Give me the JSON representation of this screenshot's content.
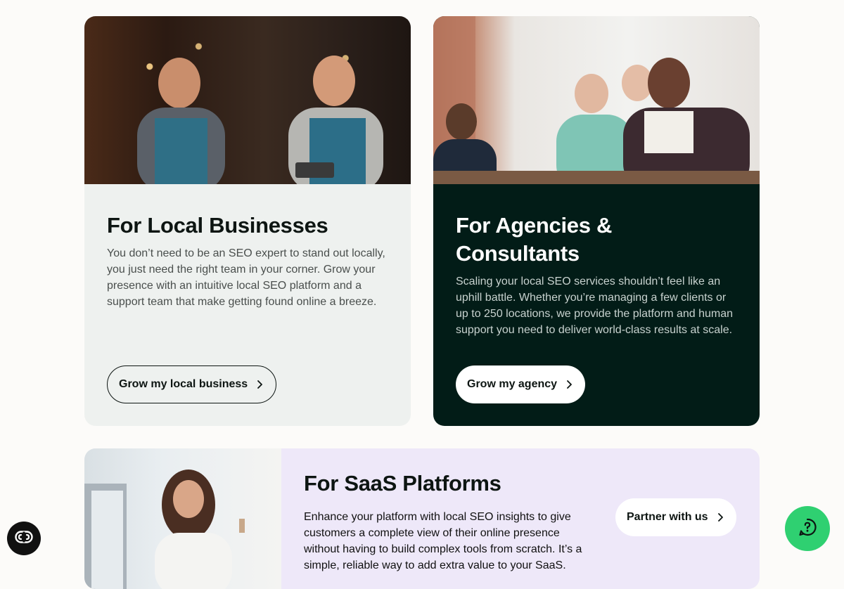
{
  "cards": {
    "local": {
      "title": "For Local Businesses",
      "description": "You don’t need to be an SEO expert to stand out locally, you just need the right team in your corner. Grow your presence with an intuitive local SEO platform and a support team that make getting found online a breeze.",
      "button_label": "Grow my local business"
    },
    "agency": {
      "title": "For Agencies & Consultants",
      "description": "Scaling your local SEO services shouldn’t feel like an uphill battle. Whether you’re managing a few clients or up to 250 locations, we provide the platform and human support you need to deliver world-class results at scale.",
      "button_label": "Grow my agency"
    },
    "saas": {
      "title": "For SaaS Platforms",
      "description": "Enhance your platform with local SEO insights to give customers a complete view of their online presence without having to build complex tools from scratch. It’s a simple, reliable way to add extra value to your SaaS.",
      "button_label": "Partner with us"
    }
  },
  "floating": {
    "accessibility_icon": "accessibility-icon",
    "chat_icon": "chat-help-icon"
  },
  "colors": {
    "local_bg": "#eef1ef",
    "agency_bg": "#021c17",
    "saas_bg": "#eee8f9",
    "chat_green": "#2fd071"
  }
}
